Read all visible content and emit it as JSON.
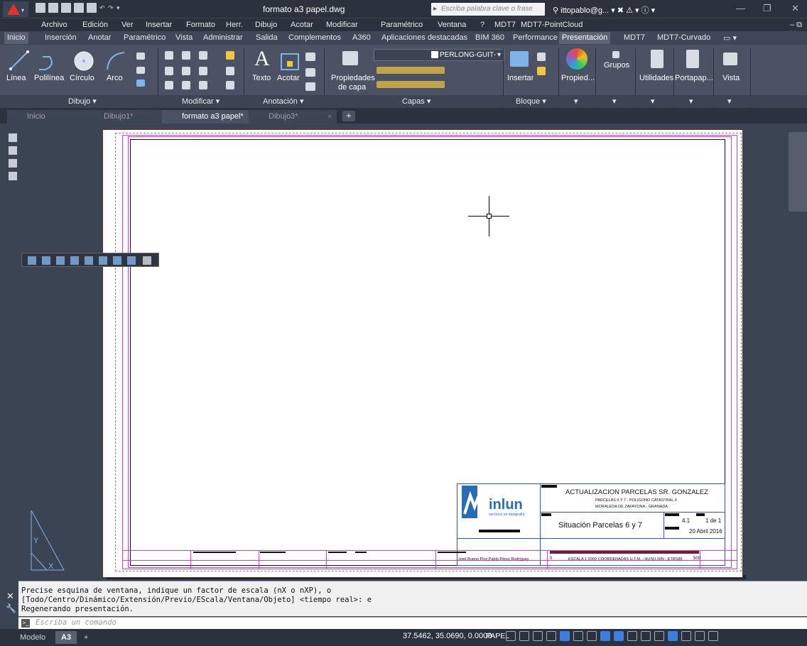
{
  "window": {
    "title": "formato a3 papel.dwg",
    "search_placeholder": "Escriba palabra clave o frase",
    "user": "ittopablo@g...",
    "min": "—",
    "restore": "❐",
    "close": "✕"
  },
  "menu": [
    "Archivo",
    "Edición",
    "Ver",
    "Insertar",
    "Formato",
    "Herr.",
    "Dibujo",
    "Acotar",
    "Modificar",
    "Paramétrico",
    "Ventana",
    "?",
    "MDT7",
    "MDT7-PointCloud"
  ],
  "ribbon_tabs": [
    "Inicio",
    "Inserción",
    "Anotar",
    "Paramétrico",
    "Vista",
    "Administrar",
    "Salida",
    "Complementos",
    "A360",
    "Aplicaciones destacadas",
    "BIM 360",
    "Performance",
    "Presentación",
    "MDT7",
    "MDT7-Curvado"
  ],
  "ribbon": {
    "draw": {
      "linea": "Línea",
      "polilinea": "Polilínea",
      "circulo": "Círculo",
      "arco": "Arco"
    },
    "annot": {
      "texto": "Texto",
      "acotar": "Acotar"
    },
    "layers": {
      "propiedades_1": "Propiedades",
      "propiedades_2": "de capa",
      "layer_name": "PERLONG-GUIT-"
    },
    "block": {
      "insertar": "Insertar"
    },
    "props": {
      "propied": "Propied..."
    },
    "groups": {
      "grupos": "Grupos"
    },
    "utils": {
      "utilidades": "Utilidades"
    },
    "clip": {
      "portapap": "Portapap..."
    },
    "view": {
      "vista": "Vista"
    },
    "panel_titles": [
      "Dibujo ▾",
      "Modificar ▾",
      "Anotación ▾",
      "Capas ▾",
      "Bloque ▾",
      "▾",
      "▾",
      "▾",
      "▾",
      "▾"
    ]
  },
  "file_tabs": [
    {
      "label": "Inicio"
    },
    {
      "label": "Dibujo1*"
    },
    {
      "label": "formato a3 papel*"
    },
    {
      "label": "Dibujo3*"
    }
  ],
  "file_tab_add": "+",
  "title_block": {
    "logo_text": "inlun",
    "logo_sub": "servicios en topografía",
    "project": "ACTUALIZACION PARCELAS SR. GONZALEZ",
    "sub1": "PARCELAS 6 Y 7 - POLIGONO CATASTRAL 4",
    "sub2": "MORALEDA DE ZAFAYONA - GRANADA",
    "plan_title": "Situación Parcelas 6 y 7",
    "sheet_no": "4.1",
    "sheet_of": "1 de 1",
    "date": "20 Abril 2016",
    "scale": "ESCALA 1:2000",
    "coords": "COORDENADAS U.T.M. - HUSO 30N - ETRS89",
    "num0": "0",
    "num500": "500",
    "people": "José Bueno Pico   Pablo Pérez Rodríguez"
  },
  "command": {
    "line1": "Precise esquina de ventana, indique un factor de escala (nX o nXP), o",
    "line2": "[Todo/Centro/Dinámico/Extensión/Previo/EScala/Ventana/Objeto] <tiempo real>: e",
    "line3": "Regenerando presentación.",
    "placeholder": "Escriba un comando"
  },
  "status": {
    "tab_model": "Modelo",
    "tab_a3": "A3",
    "tab_add": "+",
    "coords": "37.5462, 35.0690, 0.0000",
    "space": "PAPEL"
  }
}
